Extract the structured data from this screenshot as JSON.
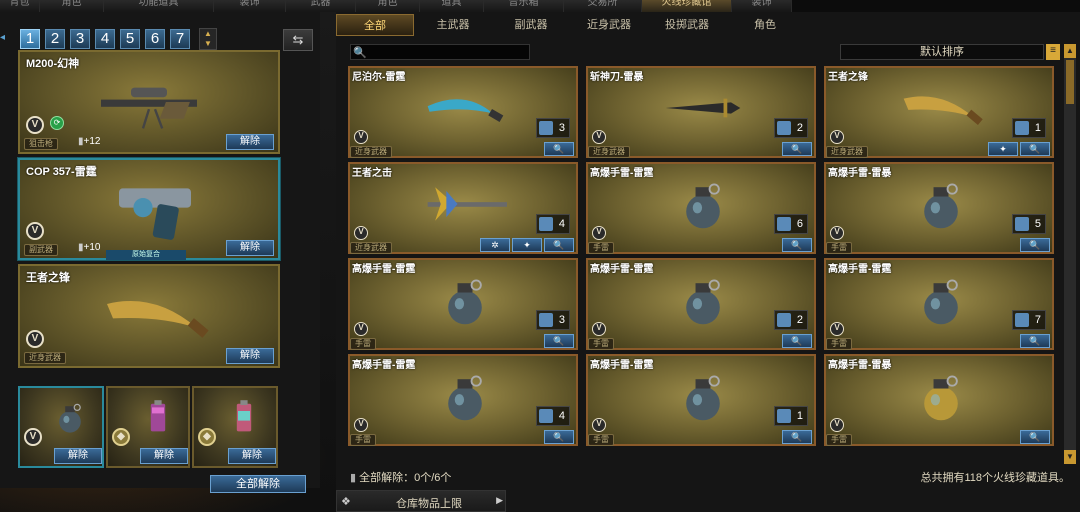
{
  "top_tabs": [
    "背包",
    "角色",
    "功能道具",
    "装饰",
    "武器",
    "角色",
    "道具",
    "音乐箱",
    "交易所",
    "火线珍藏馆",
    "装饰"
  ],
  "left": {
    "pages": [
      "1",
      "2",
      "3",
      "4",
      "5",
      "6",
      "7"
    ],
    "active_page": "1",
    "loadout": [
      {
        "title": "M200-幻神",
        "category": "狙击枪",
        "bonus": "+12",
        "remove": "解除",
        "icon": "sniper-rifle"
      },
      {
        "title": "COP 357-雷霆",
        "category": "副武器",
        "bonus": "+10",
        "remove": "解除",
        "icon": "pistol",
        "tag": "原始复合"
      },
      {
        "title": "王者之锋",
        "category": "近身武器",
        "remove": "解除",
        "icon": "blade"
      }
    ],
    "throwables": [
      {
        "remove": "解除",
        "icon": "grenade"
      },
      {
        "remove": "解除",
        "icon": "flash-canister"
      },
      {
        "remove": "解除",
        "icon": "smoke-canister"
      }
    ],
    "remove_all": "全部解除"
  },
  "right": {
    "tabs": [
      "全部",
      "主武器",
      "副武器",
      "近身武器",
      "投掷武器",
      "角色"
    ],
    "active_tab": "全部",
    "search": {
      "placeholder": "",
      "value": ""
    },
    "sort_label": "默认排序",
    "items": [
      {
        "title": "尼泊尔-雷霆",
        "category": "近身武器",
        "count": "3",
        "icon": "kukri",
        "buttons": 1
      },
      {
        "title": "斩神刀-雷暴",
        "category": "近身武器",
        "count": "2",
        "icon": "sword",
        "buttons": 1
      },
      {
        "title": "王者之锋",
        "category": "近身武器",
        "count": "1",
        "icon": "blade",
        "buttons": 2
      },
      {
        "title": "王者之击",
        "category": "近身武器",
        "count": "4",
        "icon": "axe",
        "buttons": 3
      },
      {
        "title": "高爆手雷-雷霆",
        "category": "手雷",
        "count": "6",
        "icon": "grenade",
        "buttons": 1
      },
      {
        "title": "高爆手雷-雷暴",
        "category": "手雷",
        "count": "5",
        "icon": "grenade",
        "buttons": 1
      },
      {
        "title": "高爆手雷-雷霆",
        "category": "手雷",
        "count": "3",
        "icon": "grenade",
        "buttons": 1
      },
      {
        "title": "高爆手雷-雷霆",
        "category": "手雷",
        "count": "2",
        "icon": "grenade",
        "buttons": 1
      },
      {
        "title": "高爆手雷-雷霆",
        "category": "手雷",
        "count": "7",
        "icon": "grenade",
        "buttons": 1
      },
      {
        "title": "高爆手雷-雷霆",
        "category": "手雷",
        "count": "4",
        "icon": "grenade",
        "buttons": 1
      },
      {
        "title": "高爆手雷-雷霆",
        "category": "手雷",
        "count": "1",
        "icon": "grenade",
        "buttons": 1
      },
      {
        "title": "高爆手雷-雷暴",
        "category": "手雷",
        "count": "",
        "icon": "gold-grenade",
        "buttons": 1
      }
    ],
    "footer_left": "全部解除：0个/6个",
    "footer_right": "总共拥有118个火线珍藏道具。",
    "limit_label": "仓库物品上限"
  },
  "colors": {
    "accent": "#d8a838",
    "border_orange": "#8a5a2a",
    "button_blue": "#3a6a98"
  }
}
